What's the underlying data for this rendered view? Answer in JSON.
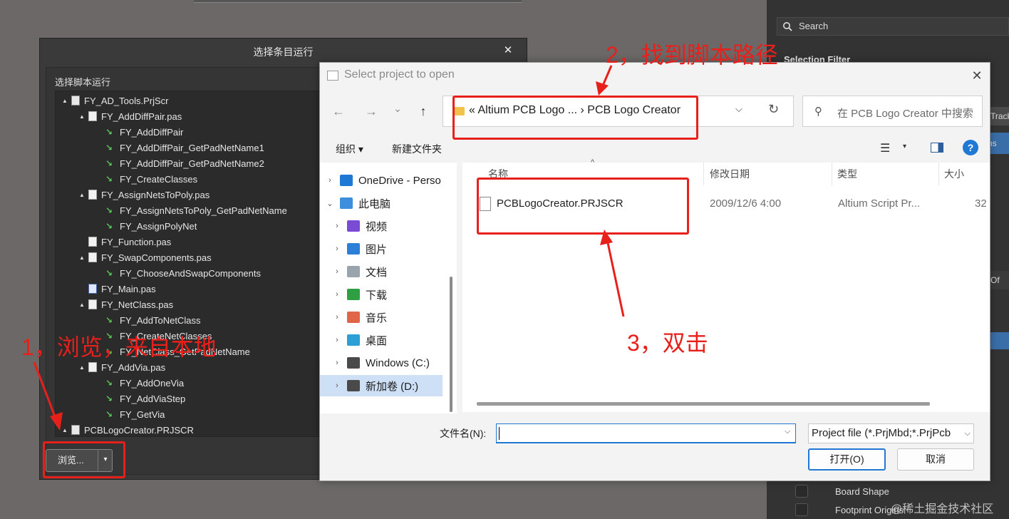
{
  "right_panel": {
    "search_placeholder": "Search",
    "selection_filter": "Selection Filter",
    "chip_track": "Track",
    "chip_ns": "ns",
    "chip_of": "Of",
    "rows": [
      "Board Shape",
      "Footprint Origins"
    ]
  },
  "script_dialog": {
    "title": "选择条目运行",
    "close": "✕",
    "subtitle": "选择脚本运行",
    "tree": [
      {
        "label": "FY_AD_Tools.PrjScr",
        "kind": "project",
        "level": 0,
        "expander": "▲"
      },
      {
        "label": "FY_AddDiffPair.pas",
        "kind": "file",
        "level": 1,
        "expander": "▲"
      },
      {
        "label": "FY_AddDiffPair",
        "kind": "proc",
        "level": 2,
        "expander": ""
      },
      {
        "label": "FY_AddDiffPair_GetPadNetName1",
        "kind": "proc",
        "level": 2,
        "expander": ""
      },
      {
        "label": "FY_AddDiffPair_GetPadNetName2",
        "kind": "proc",
        "level": 2,
        "expander": ""
      },
      {
        "label": "FY_CreateClasses",
        "kind": "proc",
        "level": 2,
        "expander": ""
      },
      {
        "label": "FY_AssignNetsToPoly.pas",
        "kind": "file",
        "level": 1,
        "expander": "▲"
      },
      {
        "label": "FY_AssignNetsToPoly_GetPadNetName",
        "kind": "proc",
        "level": 2,
        "expander": ""
      },
      {
        "label": "FY_AssignPolyNet",
        "kind": "proc",
        "level": 2,
        "expander": ""
      },
      {
        "label": "FY_Function.pas",
        "kind": "file",
        "level": 1,
        "expander": ""
      },
      {
        "label": "FY_SwapComponents.pas",
        "kind": "file",
        "level": 1,
        "expander": "▲"
      },
      {
        "label": "FY_ChooseAndSwapComponents",
        "kind": "proc",
        "level": 2,
        "expander": ""
      },
      {
        "label": "FY_Main.pas",
        "kind": "main",
        "level": 1,
        "expander": ""
      },
      {
        "label": "FY_NetClass.pas",
        "kind": "file",
        "level": 1,
        "expander": "▲"
      },
      {
        "label": "FY_AddToNetClass",
        "kind": "proc",
        "level": 2,
        "expander": ""
      },
      {
        "label": "FY_CreateNetClasses",
        "kind": "proc",
        "level": 2,
        "expander": ""
      },
      {
        "label": "FY_NetClass_GetPadNetName",
        "kind": "proc",
        "level": 2,
        "expander": ""
      },
      {
        "label": "FY_AddVia.pas",
        "kind": "file",
        "level": 1,
        "expander": "▲"
      },
      {
        "label": "FY_AddOneVia",
        "kind": "proc",
        "level": 2,
        "expander": ""
      },
      {
        "label": "FY_AddViaStep",
        "kind": "proc",
        "level": 2,
        "expander": ""
      },
      {
        "label": "FY_GetVia",
        "kind": "proc",
        "level": 2,
        "expander": ""
      },
      {
        "label": "PCBLogoCreator.PRJSCR",
        "kind": "project",
        "level": 0,
        "expander": "▲"
      }
    ],
    "browse_label": "浏览...",
    "browse_split": "▾"
  },
  "open_dialog": {
    "title": "Select project to open",
    "close": "✕",
    "nav_back": "←",
    "nav_forward": "→",
    "nav_recent": "⌄",
    "nav_up": "↑",
    "address": "«  Altium PCB Logo ...  ›  PCB Logo Creator",
    "address_dropdown": "⌵",
    "refresh": "↻",
    "search_placeholder": "在 PCB Logo Creator 中搜索",
    "toolbar_organize": "组织 ▾",
    "toolbar_new_folder": "新建文件夹",
    "view_icon": "☰",
    "view_dropdown": "▾",
    "help": "?",
    "nav_items": [
      {
        "label": "OneDrive - Perso",
        "chev": "›",
        "indent": 0,
        "color": "#1f78d4",
        "selected": false
      },
      {
        "label": "此电脑",
        "chev": "⌄",
        "indent": 0,
        "color": "#3b8fdc",
        "selected": false
      },
      {
        "label": "视频",
        "chev": "›",
        "indent": 1,
        "color": "#7a4bd4",
        "selected": false
      },
      {
        "label": "图片",
        "chev": "›",
        "indent": 1,
        "color": "#2b7fd6",
        "selected": false
      },
      {
        "label": "文档",
        "chev": "›",
        "indent": 1,
        "color": "#9aa4ad",
        "selected": false
      },
      {
        "label": "下载",
        "chev": "›",
        "indent": 1,
        "color": "#2ea043",
        "selected": false
      },
      {
        "label": "音乐",
        "chev": "›",
        "indent": 1,
        "color": "#e0664a",
        "selected": false
      },
      {
        "label": "桌面",
        "chev": "›",
        "indent": 1,
        "color": "#2b9fd6",
        "selected": false
      },
      {
        "label": "Windows (C:)",
        "chev": "›",
        "indent": 1,
        "color": "#4a4a4a",
        "selected": false
      },
      {
        "label": "新加卷 (D:)",
        "chev": "›",
        "indent": 1,
        "color": "#4a4a4a",
        "selected": true
      }
    ],
    "columns": {
      "name": "名称",
      "modified": "修改日期",
      "type": "类型",
      "size": "大小"
    },
    "files": [
      {
        "name": "PCBLogoCreator.PRJSCR",
        "modified": "2009/12/6 4:00",
        "type": "Altium Script Pr...",
        "size": "32"
      }
    ],
    "filename_label": "文件名(N):",
    "filename_value": "",
    "filetype": "Project file (*.PrjMbd;*.PrjPcb",
    "open_button": "打开(O)",
    "cancel_button": "取消"
  },
  "annotations": {
    "step1": "1，浏览，来自本地",
    "step2": "2，找到脚本路径",
    "step3": "3，双击",
    "color": "#e8201c"
  },
  "watermark": "@稀土掘金技术社区"
}
